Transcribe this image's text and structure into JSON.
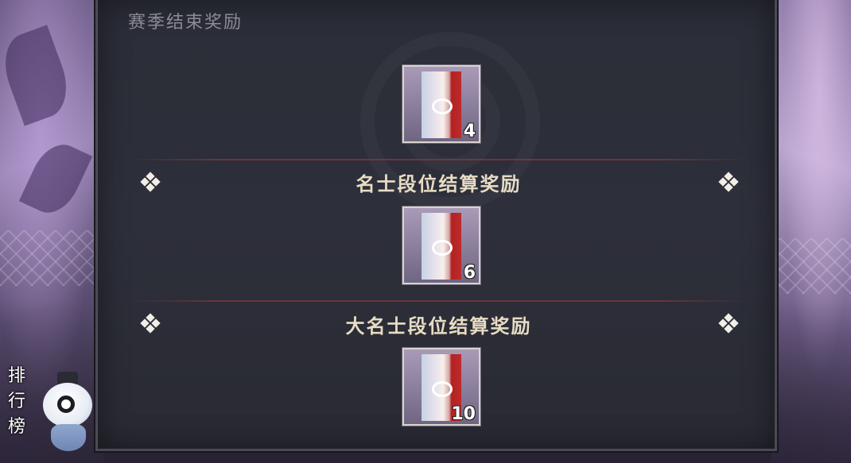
{
  "panel": {
    "title": "赛季结束奖励"
  },
  "sections": [
    {
      "heading": "",
      "reward": {
        "item": "ticket-card-icon",
        "count": "4"
      }
    },
    {
      "heading": "名士段位结算奖励",
      "reward": {
        "item": "ticket-card-icon",
        "count": "6"
      }
    },
    {
      "heading": "大名士段位结算奖励",
      "reward": {
        "item": "ticket-card-icon",
        "count": "10"
      }
    }
  ],
  "sidebar": {
    "leaderboard_label": "排行榜"
  },
  "colors": {
    "panel_bg": "#2b2d37",
    "heading_text": "#e7dcc4",
    "title_text": "#8c8a96",
    "divider": "#963c3c"
  }
}
